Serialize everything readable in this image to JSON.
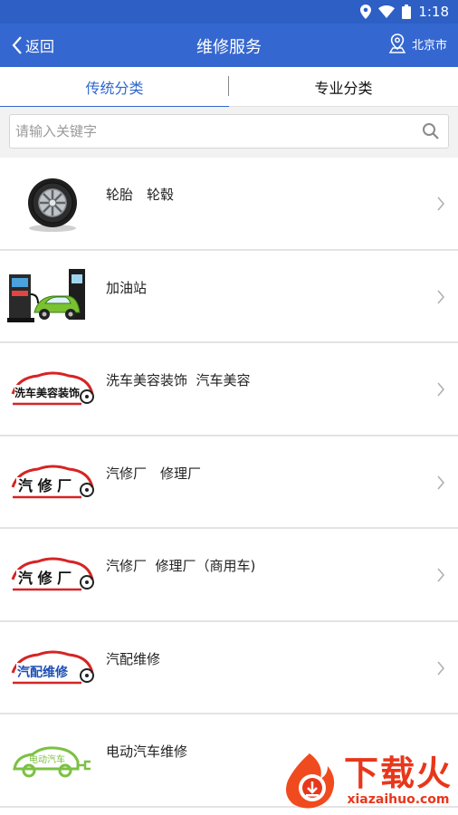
{
  "status_bar": {
    "time": "1:18"
  },
  "header": {
    "back_label": "返回",
    "title": "维修服务",
    "city": "北京市"
  },
  "tabs": [
    {
      "label": "传统分类",
      "active": true
    },
    {
      "label": "专业分类",
      "active": false
    }
  ],
  "search": {
    "placeholder": "请输入关键字",
    "value": ""
  },
  "categories": [
    {
      "label": "轮胎　轮毂",
      "icon": "tire-icon"
    },
    {
      "label": "加油站",
      "icon": "gas-station-icon"
    },
    {
      "label": "洗车美容装饰  汽车美容",
      "icon": "car-wash-logo",
      "logo_text": "洗车美容装饰"
    },
    {
      "label": "汽修厂　修理厂",
      "icon": "repair-shop-logo",
      "logo_text": "汽 修 厂"
    },
    {
      "label": "汽修厂  修理厂（商用车)",
      "icon": "repair-shop-logo",
      "logo_text": "汽 修 厂"
    },
    {
      "label": "汽配维修",
      "icon": "auto-parts-logo",
      "logo_text": "汽配维修"
    },
    {
      "label": "电动汽车维修",
      "icon": "ev-repair-logo",
      "logo_text": "电动汽车"
    }
  ],
  "watermark": {
    "brand": "下载火",
    "domain": "xiazaihuo.com"
  },
  "colors": {
    "primary": "#3567d0",
    "status": "#2d5fc4",
    "tab_active": "#2f66cf",
    "logo_red": "#d62424",
    "ev_green": "#7bc142"
  }
}
